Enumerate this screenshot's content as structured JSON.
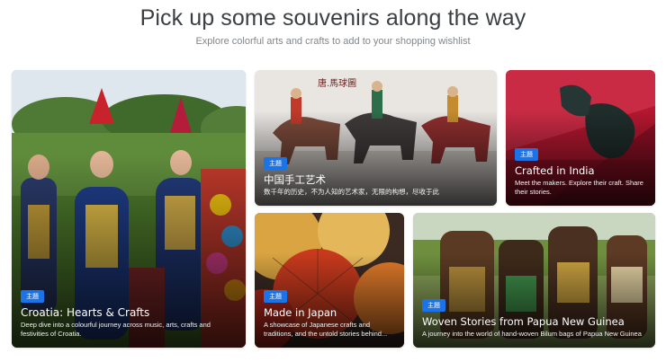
{
  "page": {
    "title": "Pick up some souvenirs along the way",
    "subtitle": "Explore colorful arts and crafts to add to your shopping wishlist"
  },
  "cards": [
    {
      "badge": "主題",
      "title": "Croatia: Hearts & Crafts",
      "description": "Deep dive into a colourful journey across music, arts, crafts and festivities of Croatia."
    },
    {
      "badge": "主題",
      "title": "中国手工艺术",
      "description": "数千年的历史，不为人知的艺术家，无限的构想，尽收于此",
      "image_text": "唐.馬球圖"
    },
    {
      "badge": "主題",
      "title": "Crafted in India",
      "description": "Meet the makers. Explore their craft. Share their stories."
    },
    {
      "badge": "主題",
      "title": "Made in Japan",
      "description": "A showcase of Japanese crafts and traditions, and the untold stories behind..."
    },
    {
      "badge": "主題",
      "title": "Woven Stories from Papua New Guinea",
      "description": "A journey into the world of hand-woven Bilum bags of Papua New Guinea"
    }
  ],
  "colors": {
    "badge": "#1a73e8",
    "heading": "#3c4043",
    "subheading": "#80868b"
  }
}
